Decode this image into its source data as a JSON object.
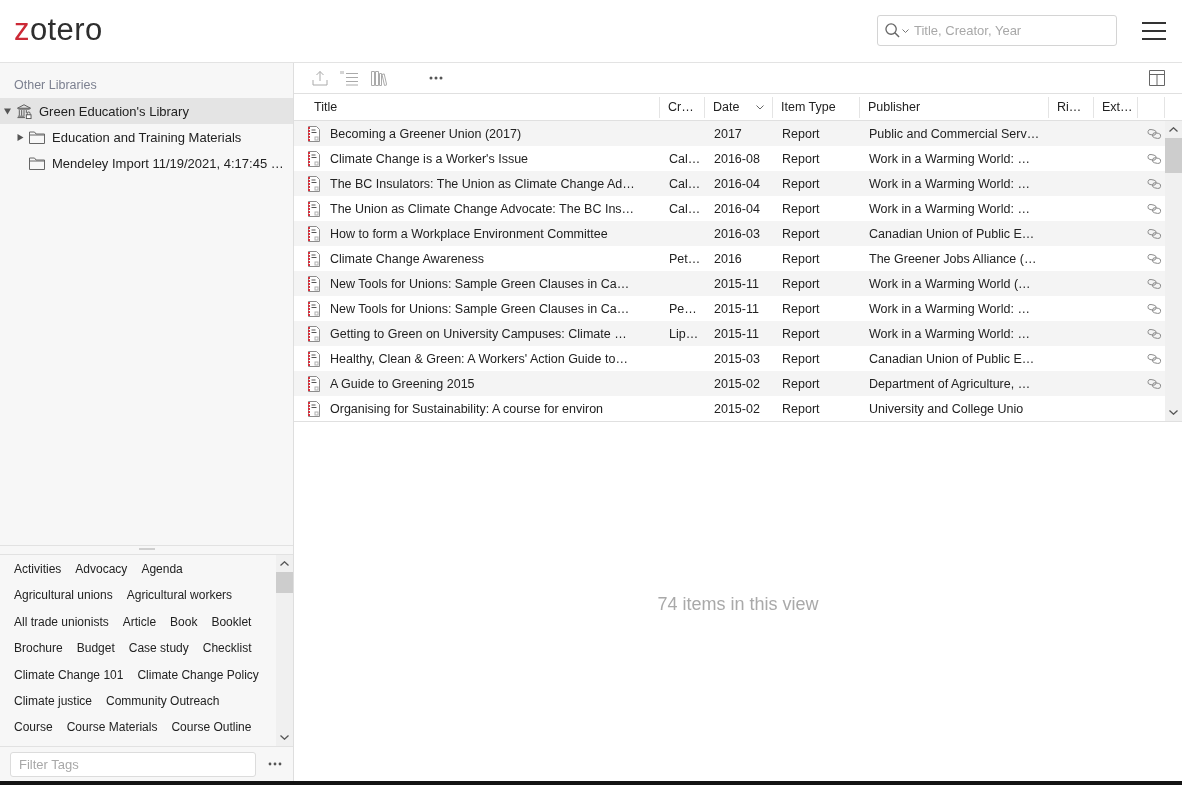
{
  "header": {
    "logo": {
      "accent": "z",
      "rest": "otero"
    },
    "search": {
      "placeholder": "Title, Creator, Year"
    }
  },
  "collections": {
    "section_label": "Other Libraries",
    "tree": [
      {
        "label": "Green Education's Library",
        "kind": "library",
        "selected": true,
        "expanded": true,
        "children": [
          {
            "label": "Education and Training Materials",
            "kind": "folder",
            "selected": false,
            "expanded": false
          },
          {
            "label": "Mendeley Import 11/19/2021, 4:17:45 …",
            "kind": "folder",
            "selected": false
          }
        ]
      }
    ]
  },
  "toolbar": {
    "buttons": [
      {
        "kind": "export",
        "disabled": true
      },
      {
        "kind": "cite",
        "disabled": true
      },
      {
        "kind": "library",
        "disabled": true
      },
      {
        "kind": "more",
        "disabled": false
      }
    ]
  },
  "table": {
    "columns": [
      {
        "label": "Title",
        "sorted": false
      },
      {
        "label": "Cr…",
        "sorted": false
      },
      {
        "label": "Date",
        "sorted": true
      },
      {
        "label": "Item Type",
        "sorted": false
      },
      {
        "label": "Publisher",
        "sorted": false
      },
      {
        "label": "Ri…",
        "sorted": false
      },
      {
        "label": "Ext…",
        "sorted": false
      }
    ],
    "rows": [
      {
        "title": "Becoming a Greener Union (2017)",
        "date": "2017",
        "item_type": "Report",
        "publisher": "Public and Commercial Serv…",
        "linked": true,
        "selected": false
      },
      {
        "title": "Climate Change is a Worker's Issue",
        "creator": "Cal…",
        "date": "2016-08",
        "item_type": "Report",
        "publisher": "Work in a Warming World: …",
        "linked": true,
        "selected": false
      },
      {
        "title": "The BC Insulators: The Union as Climate Change Ad…",
        "creator": "Cal…",
        "date": "2016-04",
        "item_type": "Report",
        "publisher": "Work in a Warming World: …",
        "linked": true,
        "selected": false
      },
      {
        "title": "The Union as Climate Change Advocate: The BC Ins…",
        "creator": "Cal…",
        "date": "2016-04",
        "item_type": "Report",
        "publisher": "Work in a Warming World: …",
        "linked": true,
        "selected": false
      },
      {
        "title": "How to form a Workplace Environment Committee",
        "date": "2016-03",
        "item_type": "Report",
        "publisher": "Canadian Union of Public E…",
        "linked": true,
        "selected": false
      },
      {
        "title": "Climate Change Awareness",
        "creator": "Pet…",
        "date": "2016",
        "item_type": "Report",
        "publisher": "The Greener Jobs Alliance (…",
        "linked": true,
        "selected": false
      },
      {
        "title": "New Tools for Unions: Sample Green Clauses in Ca…",
        "date": "2015-11",
        "item_type": "Report",
        "publisher": "Work in a Warming World (…",
        "linked": true,
        "selected": false
      },
      {
        "title": "New Tools for Unions: Sample Green Clauses in Ca…",
        "creator": "Pe…",
        "date": "2015-11",
        "item_type": "Report",
        "publisher": "Work in a Warming World: …",
        "linked": true,
        "selected": false
      },
      {
        "title": "Getting to Green on University Campuses: Climate …",
        "creator": "Lip…",
        "date": "2015-11",
        "item_type": "Report",
        "publisher": "Work in a Warming World: …",
        "linked": true,
        "selected": false
      },
      {
        "title": "Healthy, Clean & Green: A Workers' Action Guide to…",
        "date": "2015-03",
        "item_type": "Report",
        "publisher": "Canadian Union of Public E…",
        "linked": true,
        "selected": false
      },
      {
        "title": "A Guide to Greening 2015",
        "date": "2015-02",
        "item_type": "Report",
        "publisher": "Department of Agriculture, …",
        "linked": true,
        "selected": false
      },
      {
        "title": "Organising for Sustainability: A course for environ",
        "date": "2015-02",
        "item_type": "Report",
        "publisher": "University and College Unio",
        "linked": false,
        "selected": false
      }
    ]
  },
  "item_pane": {
    "message": "74 items in this view"
  },
  "tags": {
    "items": [
      {
        "label": "Activities",
        "selected": false
      },
      {
        "label": "Advocacy",
        "selected": false
      },
      {
        "label": "Agenda",
        "selected": false
      },
      {
        "label": "Agricultural unions",
        "selected": false
      },
      {
        "label": "Agricultural workers",
        "selected": false
      },
      {
        "label": "All trade unionists",
        "selected": false
      },
      {
        "label": "Article",
        "selected": false
      },
      {
        "label": "Book",
        "selected": false
      },
      {
        "label": "Booklet",
        "selected": false
      },
      {
        "label": "Brochure",
        "selected": false
      },
      {
        "label": "Budget",
        "selected": false
      },
      {
        "label": "Case study",
        "selected": false
      },
      {
        "label": "Checklist",
        "selected": false
      },
      {
        "label": "Climate Change 101",
        "selected": false
      },
      {
        "label": "Climate Change Policy",
        "selected": false
      },
      {
        "label": "Climate justice",
        "selected": false
      },
      {
        "label": "Community Outreach",
        "selected": false
      },
      {
        "label": "Course",
        "selected": false
      },
      {
        "label": "Course Materials",
        "selected": false
      },
      {
        "label": "Course Outline",
        "selected": false
      }
    ],
    "filter": {
      "placeholder": "Filter Tags"
    }
  }
}
